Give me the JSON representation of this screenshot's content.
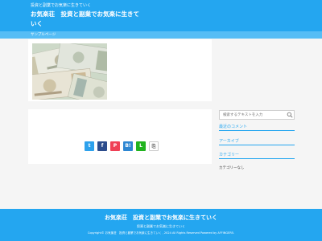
{
  "header": {
    "tagline": "投資と副業でお気楽に生きていく",
    "site_title": "お気楽荘　投資と副業でお気楽に生きていく"
  },
  "nav": {
    "items": [
      {
        "label": "サンプルページ"
      }
    ]
  },
  "article": {
    "image_alt": "",
    "share_buttons": [
      {
        "icon": "twitter-icon",
        "glyph": "t",
        "color": "#2da1ec"
      },
      {
        "icon": "facebook-icon",
        "glyph": "f",
        "color": "#2c4c8c"
      },
      {
        "icon": "pocket-icon",
        "glyph": "P",
        "color": "#ef4056"
      },
      {
        "icon": "hatena-icon",
        "glyph": "B!",
        "color": "#2d86d2"
      },
      {
        "icon": "line-icon",
        "glyph": "L",
        "color": "#21b31f"
      },
      {
        "icon": "copy-icon",
        "glyph": "⎘",
        "color": "#ffffff"
      }
    ]
  },
  "sidebar": {
    "search_placeholder": "検索するテキストを入力",
    "recent_comments_title": "最近のコメント",
    "archives_title": "アーカイブ",
    "categories_title": "カテゴリー",
    "categories_empty": "カテゴリーなし"
  },
  "footer": {
    "title": "お気楽荘　投資と副業でお気楽に生きていく",
    "tagline": "投資と副業でお気楽に生きていく",
    "copyright": "Copyright© お気楽荘　投資と副業でお気楽に生きていく , 2024 All Rights Reserved Powered by AFFINGER5."
  },
  "colors": {
    "brand": "#24a6f0",
    "nav": "#56bdf5",
    "background": "#f5f5f5"
  }
}
